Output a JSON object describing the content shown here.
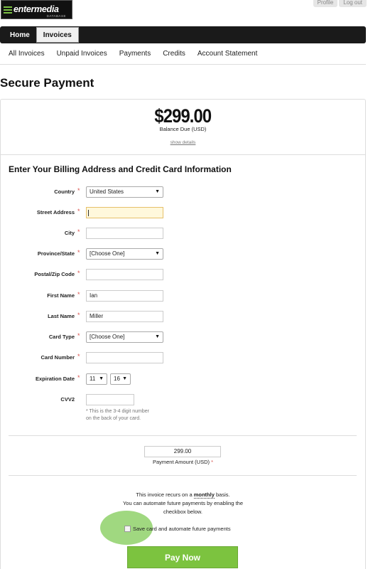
{
  "brand": {
    "logo_text": "entermedia",
    "logo_sub": "DATABASE"
  },
  "toplinks": [
    "Profile",
    "Log out"
  ],
  "nav": {
    "items": [
      "Home",
      "Invoices"
    ],
    "active": "Invoices"
  },
  "subnav": [
    "All Invoices",
    "Unpaid Invoices",
    "Payments",
    "Credits",
    "Account Statement"
  ],
  "page_title": "Secure Payment",
  "balance": {
    "amount": "$299.00",
    "label": "Balance Due (USD)",
    "details_link": "show details"
  },
  "form": {
    "title": "Enter Your Billing Address and Credit Card Information",
    "required_mark": "*",
    "country": {
      "label": "Country",
      "value": "United States"
    },
    "street": {
      "label": "Street Address",
      "value": ""
    },
    "city": {
      "label": "City",
      "value": ""
    },
    "province": {
      "label": "Province/State",
      "value": "[Choose One]"
    },
    "postal": {
      "label": "Postal/Zip Code",
      "value": ""
    },
    "first_name": {
      "label": "First Name",
      "value": "Ian"
    },
    "last_name": {
      "label": "Last Name",
      "value": "Miller"
    },
    "card_type": {
      "label": "Card Type",
      "value": "[Choose One]"
    },
    "card_number": {
      "label": "Card Number",
      "value": ""
    },
    "expiration": {
      "label": "Expiration Date",
      "month": "11",
      "year": "16"
    },
    "cvv": {
      "label": "CVV2",
      "value": "",
      "hint_line1": "* This is the 3-4 digit number",
      "hint_line2": "on the back of your card."
    }
  },
  "payment": {
    "amount": "299.00",
    "label": "Payment Amount (USD)",
    "recur_prefix": "This invoice recurs on a",
    "recur_period": "monthly",
    "recur_suffix": "basis.",
    "recur_line2": "You can automate future payments by enabling the",
    "recur_line3": "checkbox below.",
    "save_label": "Save card and automate future payments",
    "pay_button": "Pay Now"
  },
  "colors": {
    "accent": "#7cc33f",
    "required": "#d9534f",
    "nav_bg": "#1a1a1a",
    "focus_bg": "#fff8dc"
  },
  "icons": [
    "dropdown-arrow-icon",
    "logo-mark-icon"
  ]
}
